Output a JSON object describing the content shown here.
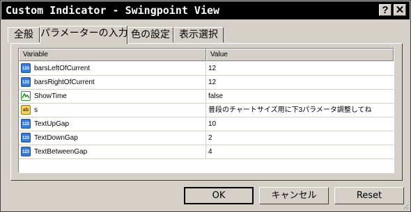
{
  "window": {
    "title": "Custom Indicator - Swingpoint View",
    "help_label": "?",
    "close_label": "✕"
  },
  "tabs": [
    {
      "label": "全般"
    },
    {
      "label": "パラメーターの入力"
    },
    {
      "label": "色の設定"
    },
    {
      "label": "表示選択"
    }
  ],
  "grid": {
    "headers": {
      "variable": "Variable",
      "value": "Value"
    },
    "rows": [
      {
        "icon": "numeric-123-icon",
        "name": "barsLeftOfCurrent",
        "value": "12"
      },
      {
        "icon": "numeric-123-icon",
        "name": "barsRightOfCurrent",
        "value": "12"
      },
      {
        "icon": "boolean-icon",
        "name": "ShowTime",
        "value": "false"
      },
      {
        "icon": "string-ab-icon",
        "name": "s",
        "value": "普段のチャートサイズ用に下3パラメータ調整してね"
      },
      {
        "icon": "numeric-123-icon",
        "name": "TextUpGap",
        "value": "10"
      },
      {
        "icon": "numeric-123-icon",
        "name": "TextDownGap",
        "value": "2"
      },
      {
        "icon": "numeric-123-icon",
        "name": "TextBetweenGap",
        "value": "4"
      }
    ]
  },
  "buttons": {
    "ok": "OK",
    "cancel": "キャンセル",
    "reset": "Reset"
  },
  "colors": {
    "titlebar": "#000000",
    "face": "#d4d0c8",
    "grid_bg": "#ffffff"
  }
}
